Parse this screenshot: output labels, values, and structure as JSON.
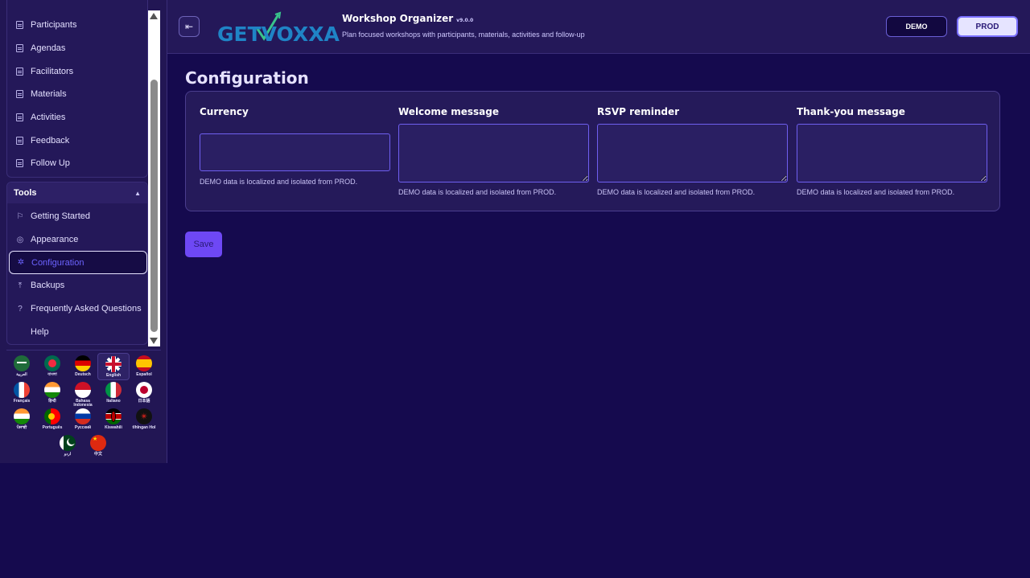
{
  "sidebar": {
    "nav_items": [
      {
        "label": "Participants",
        "icon": "document-icon"
      },
      {
        "label": "Agendas",
        "icon": "document-icon"
      },
      {
        "label": "Facilitators",
        "icon": "document-icon"
      },
      {
        "label": "Materials",
        "icon": "document-icon"
      },
      {
        "label": "Activities",
        "icon": "document-icon"
      },
      {
        "label": "Feedback",
        "icon": "document-icon"
      },
      {
        "label": "Follow Up",
        "icon": "document-icon"
      }
    ],
    "tools": {
      "title": "Tools",
      "items": [
        {
          "label": "Getting Started",
          "icon": "flag-icon"
        },
        {
          "label": "Appearance",
          "icon": "palette-icon"
        },
        {
          "label": "Configuration",
          "icon": "gear-icon",
          "active": true
        },
        {
          "label": "Backups",
          "icon": "upload-icon"
        },
        {
          "label": "Frequently Asked Questions",
          "icon": "question-icon"
        },
        {
          "label": "Help",
          "icon": "none"
        }
      ]
    },
    "languages": [
      {
        "label": "العربية"
      },
      {
        "label": "বাংলা"
      },
      {
        "label": "Deutsch"
      },
      {
        "label": "English",
        "selected": true
      },
      {
        "label": "Español"
      },
      {
        "label": "Français"
      },
      {
        "label": "हिन्दी"
      },
      {
        "label": "Bahasa Indonesia"
      },
      {
        "label": "Italiano"
      },
      {
        "label": "日本語"
      },
      {
        "label": "ਪੰਜਾਬੀ"
      },
      {
        "label": "Português"
      },
      {
        "label": "Русский"
      },
      {
        "label": "Kiswahili"
      },
      {
        "label": "tlhIngan Hol"
      },
      {
        "label": "اردو"
      },
      {
        "label": "中文"
      }
    ]
  },
  "header": {
    "logo_text": "GETVOXXA",
    "app_title": "Workshop Organizer",
    "version": "v9.0.0",
    "subtitle": "Plan focused workshops with participants, materials, activities and follow-up",
    "demo_label": "DEMO",
    "prod_label": "PROD"
  },
  "main": {
    "title": "Configuration",
    "fields": [
      {
        "label": "Currency",
        "value": "",
        "hint": "DEMO data is localized and isolated from PROD."
      },
      {
        "label": "Welcome message",
        "value": "",
        "hint": "DEMO data is localized and isolated from PROD."
      },
      {
        "label": "RSVP reminder",
        "value": "",
        "hint": "DEMO data is localized and isolated from PROD."
      },
      {
        "label": "Thank-you message",
        "value": "",
        "hint": "DEMO data is localized and isolated from PROD."
      }
    ],
    "save_label": "Save"
  },
  "colors": {
    "background": "#150a4e",
    "panel": "#241859",
    "accent": "#6e48f5",
    "active_text": "#6c63ff"
  }
}
